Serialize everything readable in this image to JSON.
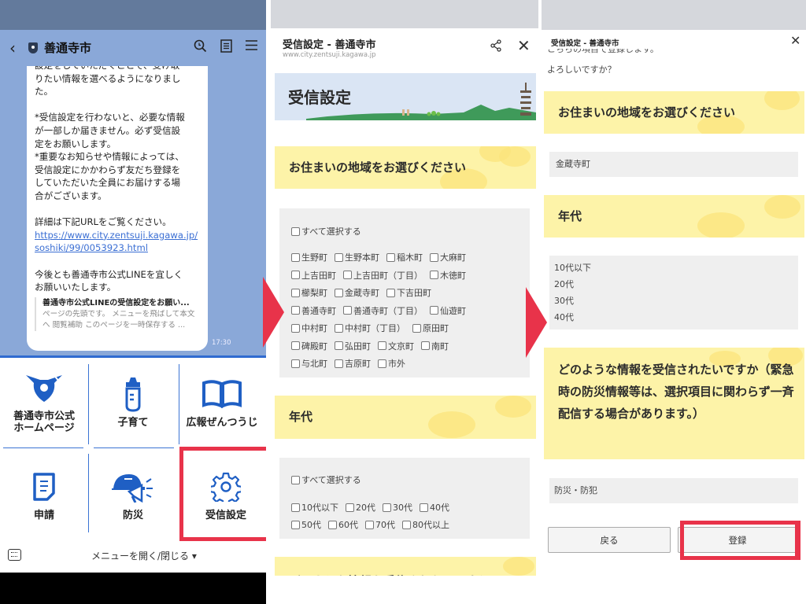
{
  "panel1": {
    "header": {
      "back_icon": "‹",
      "title": "善通寺市",
      "search_icon": "search",
      "notes_icon": "notes",
      "menu_icon": "menu"
    },
    "message": {
      "text": "設定をしていただくことで、受け取\nりたい情報を選べるようになりまし\nた。\n\n*受信設定を行わないと、必要な情報\nが一部しか届きません。必ず受信設\n定をお願いします。\n*重要なお知らせや情報によっては、\n受信設定にかかわらず友だち登録を\nしていただいた全員にお届けする場\n合がございます。\n\n詳細は下記URLをご覧ください。",
      "link": "https://www.city.zentsuji.kagawa.jp/soshiki/99/0053923.html",
      "closing": "\n今後とも善通寺市公式LINEを宜しく\nお願いいたします。",
      "preview_title": "善通寺市公式LINEの受信設定をお願い...",
      "preview_desc": "ページの先頭です。 メニューを飛ばして本文へ 閲覧補助 このページを一時保存する ...",
      "time": "17:30"
    },
    "rich_menu": [
      {
        "label": "善通寺市公式\nホームページ",
        "icon": "city-emblem"
      },
      {
        "label": "子育て",
        "icon": "baby-bottle"
      },
      {
        "label": "広報ぜんつうじ",
        "icon": "open-book"
      },
      {
        "label": "申請",
        "icon": "document"
      },
      {
        "label": "防災",
        "icon": "helmet-megaphone"
      },
      {
        "label": "受信設定",
        "icon": "gear"
      }
    ],
    "menu_toggle": "メニューを開く/閉じる ▾"
  },
  "panel2": {
    "title": "受信設定 - 善通寺市",
    "url": "www.city.zentsuji.kagawa.jp",
    "hero_title": "受信設定",
    "area_heading": "お住まいの地域をお選びください",
    "select_all": "すべて選択する",
    "area_rows": [
      [
        "生野町",
        "生野本町",
        "稲木町",
        "大麻町"
      ],
      [
        "上吉田町",
        "上吉田町（丁目）",
        "木徳町"
      ],
      [
        "櫛梨町",
        "金蔵寺町",
        "下吉田町"
      ],
      [
        "善通寺町",
        "善通寺町（丁目）",
        "仙遊町"
      ],
      [
        "中村町",
        "中村町（丁目）",
        "原田町"
      ],
      [
        "碑殿町",
        "弘田町",
        "文京町",
        "南町"
      ],
      [
        "与北町",
        "吉原町",
        "市外"
      ]
    ],
    "age_heading": "年代",
    "age_rows": [
      [
        "10代以下",
        "20代",
        "30代",
        "40代"
      ],
      [
        "50代",
        "60代",
        "70代",
        "80代以上"
      ]
    ],
    "info_heading_partial": "どのような情報を受信されたいですか"
  },
  "panel3": {
    "title": "受信設定 - 善通寺市",
    "cut_text": "こちらの項目で登録します。",
    "confirm": "よろしいですか？",
    "area_heading": "お住まいの地域をお選びください",
    "area_value": "金蔵寺町",
    "age_heading": "年代",
    "age_values": [
      "10代以下",
      "20代",
      "30代",
      "40代"
    ],
    "info_heading": "どのような情報を受信されたいですか（緊急時の防災情報等は、選択項目に関わらず一斉配信する場合があります。）",
    "info_value": "防災・防犯",
    "back_button": "戻る",
    "register_button": "登録"
  },
  "colors": {
    "highlight": "#e8334a",
    "line_blue": "#1f5fc4",
    "chat_bg": "#8aa8d8",
    "heading_yellow": "#fdf3a8",
    "box_gray": "#efefef"
  }
}
